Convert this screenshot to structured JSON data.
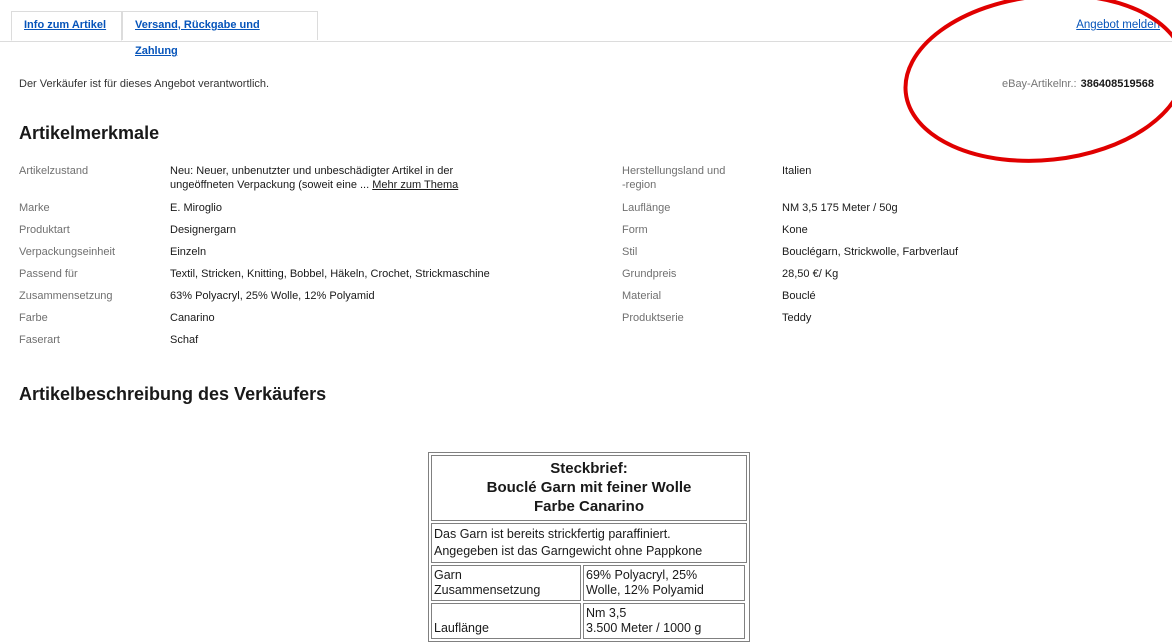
{
  "tabs": [
    {
      "label": "Info zum Artikel"
    },
    {
      "label": "Versand, Rückgabe und Zahlung"
    }
  ],
  "report_link": "Angebot melden",
  "seller_note": "Der Verkäufer ist für dieses Angebot verantwortlich.",
  "item_number": {
    "label": "eBay-Artikelnr.:",
    "value": "386408519568"
  },
  "specs_title": "Artikelmerkmale",
  "specs_left": [
    {
      "label": "Artikelzustand",
      "value_line1": "Neu: Neuer, unbenutzter und unbeschädigter Artikel in der",
      "value_line2": "ungeöffneten Verpackung (soweit eine ...",
      "more": "Mehr zum Thema"
    },
    {
      "label": "Marke",
      "value": "E. Miroglio"
    },
    {
      "label": "Produktart",
      "value": "Designergarn"
    },
    {
      "label": "Verpackungseinheit",
      "value": "Einzeln"
    },
    {
      "label": "Passend für",
      "value": "Textil, Stricken, Knitting, Bobbel, Häkeln, Crochet, Strickmaschine"
    },
    {
      "label": "Zusammensetzung",
      "value": "63% Polyacryl, 25% Wolle, 12% Polyamid"
    },
    {
      "label": "Farbe",
      "value": "Canarino"
    },
    {
      "label": "Faserart",
      "value": "Schaf"
    }
  ],
  "specs_right": [
    {
      "label_line1": "Herstellungsland und",
      "label_line2": "-region",
      "value": "Italien"
    },
    {
      "label": "Lauflänge",
      "value": "NM 3,5 175 Meter / 50g"
    },
    {
      "label": "Form",
      "value": "Kone"
    },
    {
      "label": "Stil",
      "value": "Bouclégarn, Strickwolle, Farbverlauf"
    },
    {
      "label": "Grundpreis",
      "value": "28,50 €/ Kg"
    },
    {
      "label": "Material",
      "value": "Bouclé"
    },
    {
      "label": "Produktserie",
      "value": "Teddy"
    }
  ],
  "description_title": "Artikelbeschreibung des Verkäufers",
  "description": {
    "head_line1": "Steckbrief:",
    "head_line2": "Bouclé Garn mit feiner Wolle",
    "head_line3": "Farbe Canarino",
    "note_line1": "Das Garn ist bereits strickfertig paraffiniert.",
    "note_line2": "Angegeben ist das Garngewicht ohne Pappkone",
    "rows": [
      {
        "k1": "Garn",
        "k2": "Zusammensetzung",
        "v1": "69% Polyacryl, 25%",
        "v2": "Wolle, 12% Polyamid"
      },
      {
        "k1": "",
        "k2": "Lauflänge",
        "v1": "Nm 3,5",
        "v2": "3.500 Meter / 1000 g"
      }
    ]
  },
  "colors": {
    "link": "#0654ba",
    "annotation": "#e00000"
  }
}
